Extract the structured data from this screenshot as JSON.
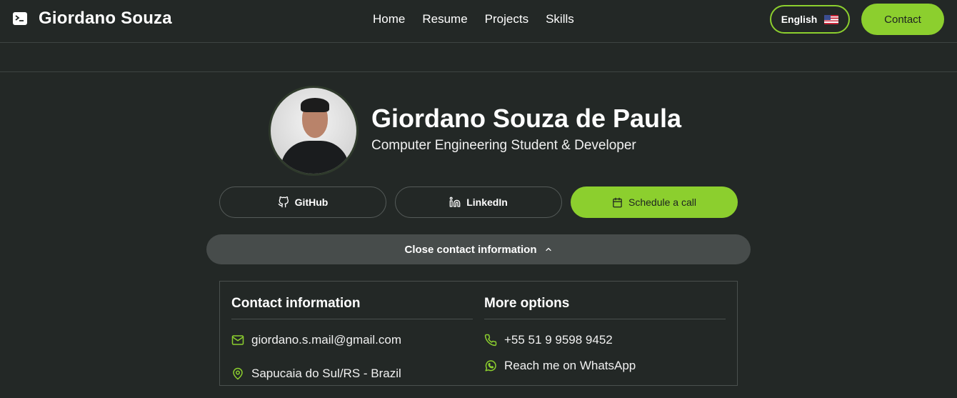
{
  "header": {
    "brand": "Giordano Souza",
    "nav": [
      "Home",
      "Resume",
      "Projects",
      "Skills"
    ],
    "language_label": "English",
    "contact_label": "Contact"
  },
  "profile": {
    "name": "Giordano Souza de Paula",
    "title": "Computer Engineering Student & Developer"
  },
  "actions": {
    "github_label": "GitHub",
    "linkedin_label": "LinkedIn",
    "schedule_label": "Schedule a call"
  },
  "toggle": {
    "label": "Close contact information"
  },
  "contact_panel": {
    "left_title": "Contact information",
    "email": "giordano.s.mail@gmail.com",
    "location": "Sapucaia do Sul/RS - Brazil",
    "right_title": "More options",
    "phone": "+55 51 9 9598 9452",
    "whatsapp": "Reach me on WhatsApp"
  },
  "colors": {
    "background": "#232826",
    "accent": "#8ccf2e",
    "toggle_bg": "#474c4b"
  },
  "icons": [
    "terminal-icon",
    "us-flag-icon",
    "github-icon",
    "linkedin-icon",
    "calendar-icon",
    "chevron-up-icon",
    "mail-icon",
    "location-pin-icon",
    "phone-icon",
    "whatsapp-icon"
  ]
}
